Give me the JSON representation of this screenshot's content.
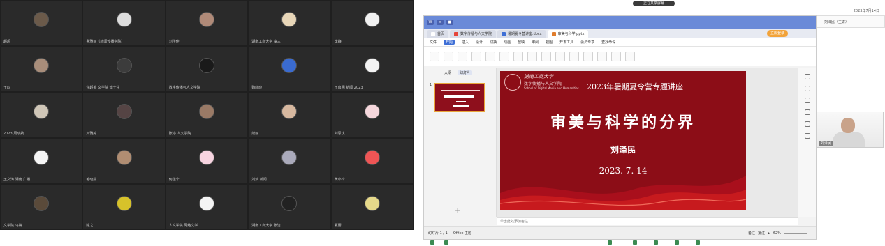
{
  "participants": [
    {
      "name": "超超"
    },
    {
      "name": "鲁雅丽（新闻传播学院）"
    },
    {
      "name": "刘佳佳"
    },
    {
      "name": "湖南工商大学 童三"
    },
    {
      "name": "李静"
    },
    {
      "name": "王四"
    },
    {
      "name": "许超英 文学院 博士生"
    },
    {
      "name": "数字传播与人文学院"
    },
    {
      "name": "魏晓晓"
    },
    {
      "name": "王启明 新闻 2023"
    },
    {
      "name": "2023 周晓航"
    },
    {
      "name": "刘雅婷"
    },
    {
      "name": "张沁 人文学院"
    },
    {
      "name": "熊丽"
    },
    {
      "name": "刘思琪"
    },
    {
      "name": "王文涛 湖南 广播"
    },
    {
      "name": "毛晓燕"
    },
    {
      "name": "何佳宁"
    },
    {
      "name": "刘梦 新闻"
    },
    {
      "name": "黄小玲"
    },
    {
      "name": "文学院 马婧"
    },
    {
      "name": "陈之"
    },
    {
      "name": "人文学院 网络文学"
    },
    {
      "name": "湖南工商大学 张洁"
    },
    {
      "name": "夏蕾"
    }
  ],
  "share": {
    "pill": "正在共享屏幕",
    "topright": "2023年7月14日"
  },
  "wps": {
    "tabs": [
      {
        "label": "首页",
        "color": "#ffffff"
      },
      {
        "label": "数字传播与人文学院",
        "color": "#e5453a"
      },
      {
        "label": "暑期夏令营讲座.docx",
        "color": "#3f6fd6"
      },
      {
        "label": "审美与科学.pptx",
        "color": "#e07d2d"
      }
    ],
    "user_badge": "立即登录",
    "menus": [
      "文件",
      "开始",
      "插入",
      "设计",
      "切换",
      "动画",
      "放映",
      "审阅",
      "视图",
      "开发工具",
      "会员专享",
      "查找命令"
    ],
    "active_menu": "开始",
    "view_tabs": {
      "outline": "大纲",
      "slides": "幻灯片"
    },
    "slide_index": "1",
    "notes_placeholder": "单击此处添加备注",
    "status": {
      "page": "幻灯片 1 / 1",
      "theme": "Office 主题",
      "notes": "备注",
      "comment": "批注",
      "zoom": "62%"
    }
  },
  "slide": {
    "school_cn": "湖南工商大学",
    "school_line": "数字传播与人文学院",
    "school_en": "School of Digital Media and Humanities",
    "banner": "2023年暑期夏令营专题讲座",
    "title": "审美与科学的分界",
    "speaker": "刘泽民",
    "date": "2023. 7. 14"
  },
  "speaker_video": {
    "label": "刘泽民",
    "mini_label": "刘泽民（主讲）"
  },
  "colors": {
    "slide_bg": "#8c0d17",
    "accent": "#3f6fd6",
    "tile_bg": "#2a2a2a"
  }
}
